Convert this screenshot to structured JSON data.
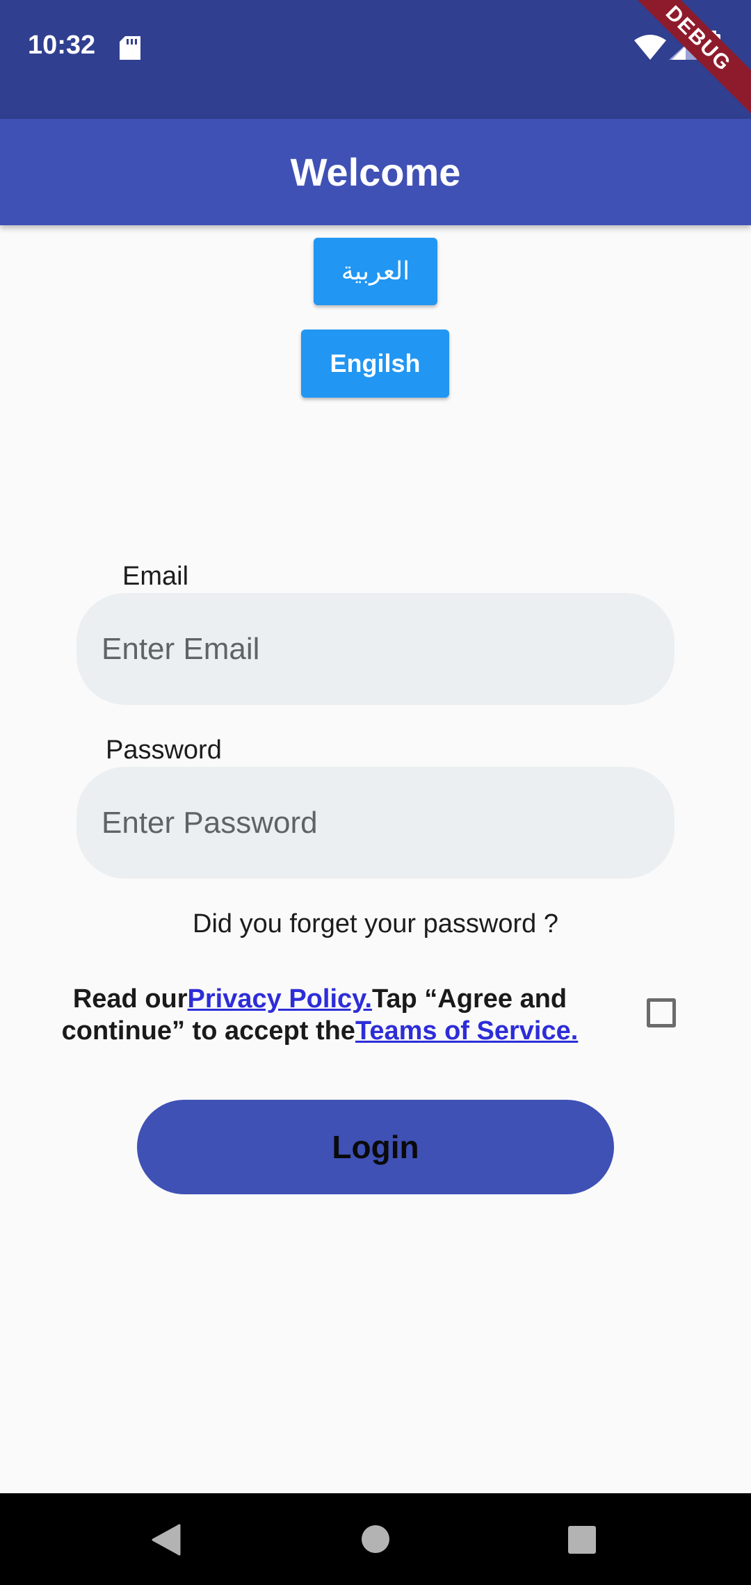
{
  "status_bar": {
    "time": "10:32",
    "debug_label": "DEBUG",
    "icons": [
      "sd-card-icon",
      "wifi-icon",
      "signal-icon",
      "battery-icon"
    ]
  },
  "app_bar": {
    "title": "Welcome"
  },
  "language_buttons": {
    "arabic": "العربية",
    "english": "Engilsh"
  },
  "form": {
    "email_label": "Email",
    "email_placeholder": "Enter Email",
    "password_label": "Password",
    "password_placeholder": "Enter Password",
    "forgot": "Did you forget your password ?"
  },
  "terms": {
    "prefix": "Read our",
    "privacy_link": "Privacy Policy.",
    "middle": "Tap “Agree and continue” to accept the",
    "terms_link": "Teams of Service.",
    "checked": false
  },
  "login": {
    "label": "Login"
  },
  "nav_bar": {
    "icons": [
      "back-icon",
      "home-icon",
      "recents-icon"
    ]
  },
  "colors": {
    "status_bar": "#303f8f",
    "app_bar": "#3f51b5",
    "language_button": "#2196f3",
    "field_background": "#eceff1",
    "link": "#2d2dd8"
  }
}
